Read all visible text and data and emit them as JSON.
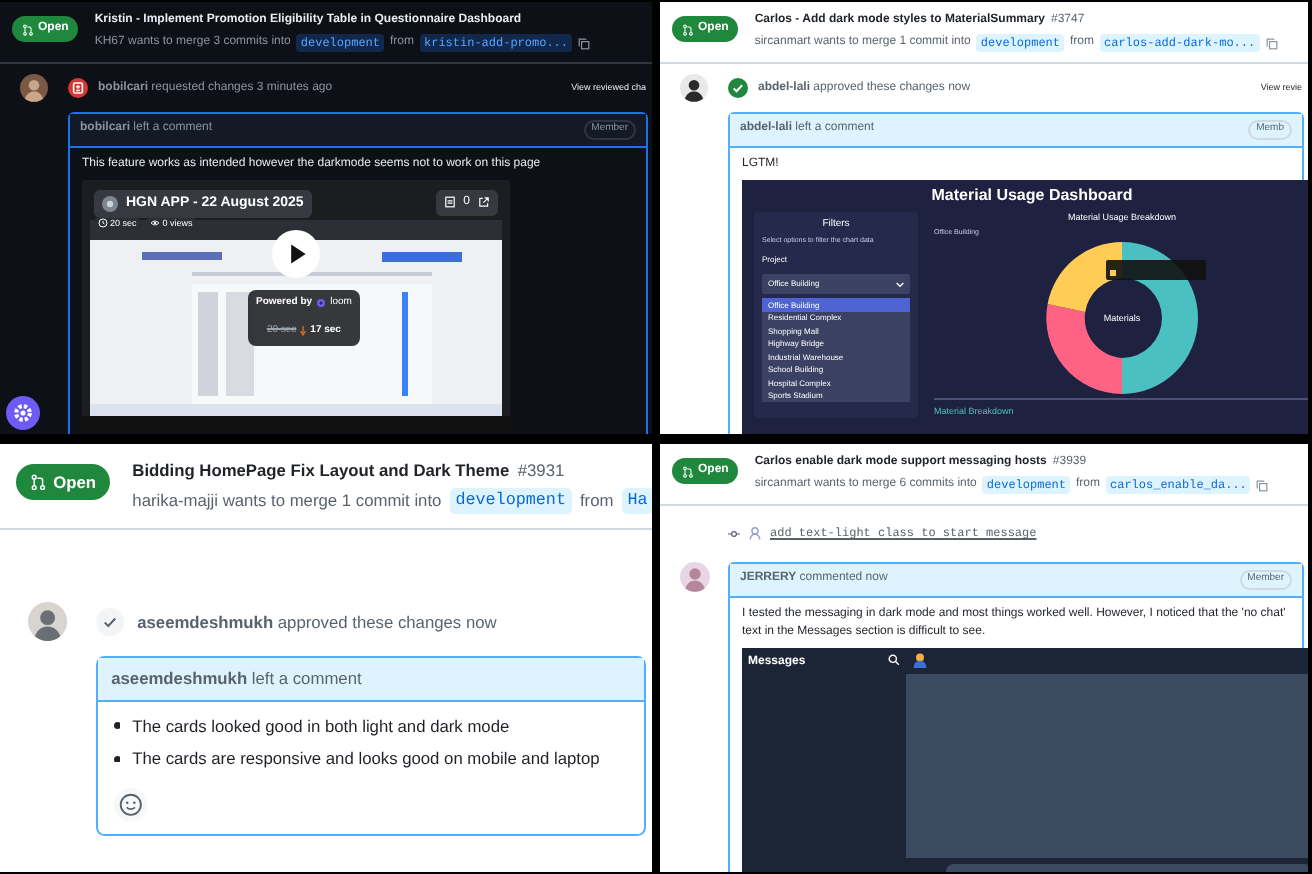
{
  "panels": [
    {
      "dark_mode": true,
      "status": "Open",
      "title": "Kristin - Implement Promotion Eligibility Table in Questionnaire Dashboard",
      "merge_text": "KH67 wants to merge 3 commits into",
      "base": "development",
      "from": "from",
      "head": "kristin-add-promo...",
      "review": {
        "kind": "changes_requested",
        "text": "**bobilcari** requested changes 3 minutes ago",
        "link": "View reviewed cha"
      },
      "comment": {
        "header": "**bobilcari** left a comment",
        "role": "Member",
        "body": "This feature works as intended however the darkmode seems not to work on this page"
      },
      "attachment": {
        "kind": "video",
        "title": "HGN APP - 22 August 2025",
        "duration": "20 sec",
        "views": "0 views",
        "comments": "0",
        "powered": "Powered by",
        "brand": "loom",
        "old_time": "20 sec",
        "new_time": "17 sec"
      }
    },
    {
      "dark_mode": false,
      "status": "Open",
      "title": "Carlos - Add dark mode styles to MaterialSummary",
      "number": "#3747",
      "merge_text": "sircanmart wants to merge 1 commit into",
      "base": "development",
      "from": "from",
      "head": "carlos-add-dark-mo...",
      "review": {
        "kind": "approved",
        "text": "**abdel-lali** approved these changes now",
        "link": "View revie"
      },
      "comment": {
        "header": "**abdel-lali** left a comment",
        "role": "Memb",
        "body": "LGTM!"
      },
      "attachment": {
        "kind": "dashboard",
        "title": "Material Usage Dashboard",
        "filters_title": "Filters",
        "filters_hint": "Select options to filter the chart data",
        "field_label": "Project",
        "select_value": "Office Building",
        "options": [
          {
            "label": "Office Building",
            "selected": true
          },
          {
            "label": "Residential Complex",
            "selected": false
          },
          {
            "label": "Shopping Mall",
            "selected": false
          },
          {
            "label": "Highway Bridge",
            "selected": false
          },
          {
            "label": "Industrial Warehouse",
            "selected": false
          },
          {
            "label": "School Building",
            "selected": false
          },
          {
            "label": "Hospital Complex",
            "selected": false
          },
          {
            "label": "Sports Stadium",
            "selected": false
          }
        ],
        "chart_title": "Material Usage Breakdown",
        "chart_subtitle": "Office Building",
        "donut_label": "Materials",
        "section_title": "Material Breakdown"
      }
    },
    {
      "dark_mode": false,
      "status": "Open",
      "title": "Bidding HomePage Fix Layout and Dark Theme",
      "number": "#3931",
      "merge_text": "harika-majji wants to merge 1 commit into",
      "base": "development",
      "from": "from",
      "head": "Ha",
      "review": {
        "kind": "approved_muted",
        "text": "**aseemdeshmukh** approved these changes now"
      },
      "comment": {
        "header": "**aseemdeshmukh** left a comment",
        "bullets": [
          "The cards looked good in both light and dark mode",
          "The cards are responsive and looks good on mobile and laptop"
        ],
        "reactions": true
      }
    },
    {
      "dark_mode": false,
      "status": "Open",
      "title": "Carlos enable dark mode support messaging hosts",
      "number": "#3939",
      "merge_text": "sircanmart wants to merge 6 commits into",
      "base": "development",
      "from": "from",
      "head": "carlos_enable_da...",
      "commit": "add text-light class to start message",
      "comment": {
        "header": "**JERRERY** commented now",
        "role": "Member",
        "body": "I tested the messaging in dark mode and most things worked well. However, I noticed that the 'no chat' text in the Messages section is difficult to see."
      },
      "attachment": {
        "kind": "messages",
        "title": "Messages"
      }
    }
  ]
}
